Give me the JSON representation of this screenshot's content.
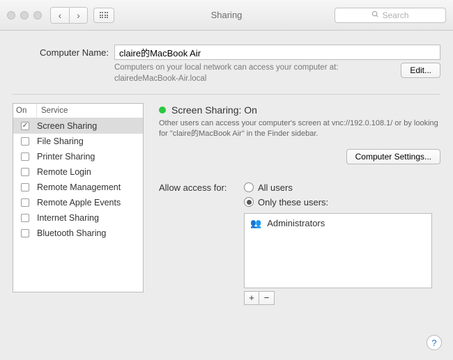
{
  "titlebar": {
    "title": "Sharing",
    "searchPlaceholder": "Search"
  },
  "computerName": {
    "label": "Computer Name:",
    "value": "claire的MacBook Air",
    "subtext1": "Computers on your local network can access your computer at:",
    "subtext2": "clairedeMacBook-Air.local",
    "editBtn": "Edit..."
  },
  "services": {
    "headerOn": "On",
    "headerService": "Service",
    "items": [
      {
        "on": true,
        "label": "Screen Sharing",
        "selected": true
      },
      {
        "on": false,
        "label": "File Sharing"
      },
      {
        "on": false,
        "label": "Printer Sharing"
      },
      {
        "on": false,
        "label": "Remote Login"
      },
      {
        "on": false,
        "label": "Remote Management"
      },
      {
        "on": false,
        "label": "Remote Apple Events"
      },
      {
        "on": false,
        "label": "Internet Sharing"
      },
      {
        "on": false,
        "label": "Bluetooth Sharing"
      }
    ]
  },
  "detail": {
    "statusTitle": "Screen Sharing: On",
    "statusDesc": "Other users can access your computer's screen at vnc://192.0.108.1/ or by looking for \"claire的MacBook Air\" in the Finder sidebar.",
    "computerSettingsBtn": "Computer Settings...",
    "allowLabel": "Allow access for:",
    "radioAll": "All users",
    "radioOnly": "Only these users:",
    "user1": "Administrators"
  }
}
